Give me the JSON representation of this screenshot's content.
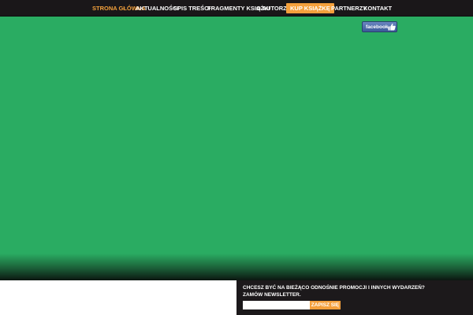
{
  "nav": {
    "items": [
      {
        "label": "STRONA GŁÓWNA",
        "state": "active"
      },
      {
        "label": "AKTUALNOŚCI",
        "state": "normal"
      },
      {
        "label": "SPIS TREŚCI",
        "state": "normal"
      },
      {
        "label": "FRAGMENTY KSIĄŻKI",
        "state": "normal"
      },
      {
        "label": "O AUTORZE",
        "state": "normal"
      },
      {
        "label": "KUP KSIĄŻKĘ",
        "state": "highlight"
      },
      {
        "label": "PARTNERZY",
        "state": "normal"
      },
      {
        "label": "KONTAKT",
        "state": "normal"
      }
    ]
  },
  "facebook": {
    "label": "facebook",
    "icon": "thumbs-up-icon"
  },
  "newsletter": {
    "line1": "CHCESZ BYĆ NA BIEŻĄCO ODNOŚNIE PROMOCJI I INNYCH WYDARZEŃ?",
    "line2": "ZAMÓW NEWSLETTER.",
    "input_value": "",
    "button_label": "ZAPISZ SIĘ"
  },
  "colors": {
    "nav_background": "#1a1719",
    "accent": "#f4a03c",
    "active_link": "#f3a13c",
    "content_background": "#2aac62",
    "facebook": "#3b5998"
  }
}
